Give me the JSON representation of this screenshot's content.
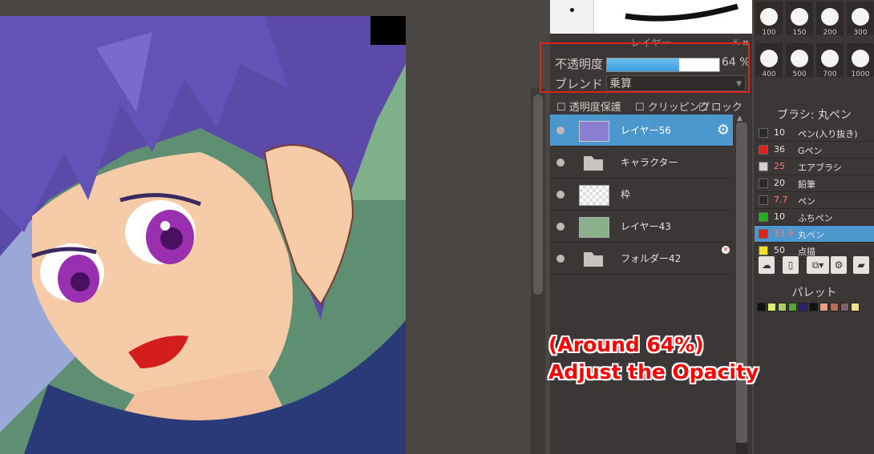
{
  "layer_panel": {
    "title": "レイヤー",
    "opacity_label": "不透明度",
    "opacity_value": "64 %",
    "opacity_fraction": 0.64,
    "blend_label": "ブレンド",
    "blend_mode": "乗算",
    "checkbox_transparency": "透明度保護",
    "checkbox_clip": "クリッピング",
    "checkbox_lock": "ロック",
    "layers": [
      {
        "name": "レイヤー56",
        "type": "layer",
        "selected": true
      },
      {
        "name": "キャラクター",
        "type": "folder"
      },
      {
        "name": "枠",
        "type": "layer"
      },
      {
        "name": "レイヤー43",
        "type": "layer"
      },
      {
        "name": "フォルダー42",
        "type": "folder"
      }
    ]
  },
  "brush_sizes": [
    "100",
    "150",
    "200",
    "300",
    "400",
    "500",
    "700",
    "1000"
  ],
  "brush_panel": {
    "title": "ブラシ: 丸ペン",
    "brushes": [
      {
        "size": "10",
        "name": "ペン(入り抜き)",
        "color": "#2a2a2a"
      },
      {
        "size": "36",
        "name": "Gペン",
        "color": "#e02020"
      },
      {
        "size": "25",
        "name": "エアブラシ",
        "color": "#d0d0d0"
      },
      {
        "size": "20",
        "name": "鉛筆",
        "color": "#2a2a2a"
      },
      {
        "size": "7.7",
        "name": "ペン",
        "color": "#2a2a2a"
      },
      {
        "size": "10",
        "name": "ふちペン",
        "color": "#20b020"
      },
      {
        "size": "13.9",
        "name": "丸ペン",
        "color": "#e02020",
        "selected": true
      },
      {
        "size": "50",
        "name": "点描",
        "color": "#f0e020"
      }
    ]
  },
  "palette_panel": {
    "title": "パレット",
    "colors": [
      "#111111",
      "#d8f070",
      "#a8d060",
      "#60a040",
      "#2a2070",
      "#111111",
      "#f0a080",
      "#b07060",
      "#806070",
      "#f0e090"
    ]
  },
  "annotation": {
    "line1": "(Around 64%)",
    "line2": "Adjust the Opacity"
  }
}
